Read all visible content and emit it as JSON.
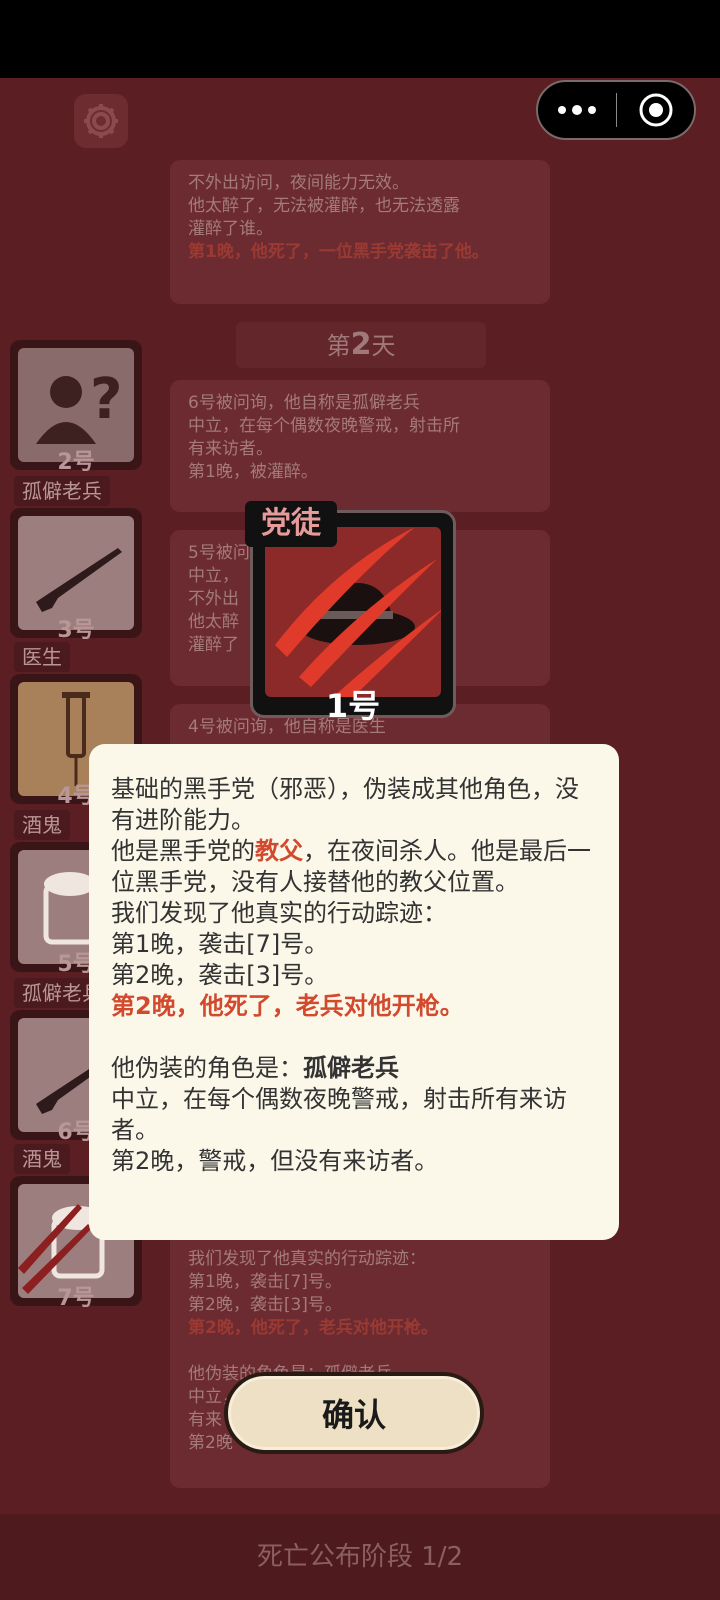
{
  "colors": {
    "background": "#5b1e22",
    "dialog_background": "#fbf8ea",
    "highlight_red": "#d2492e",
    "role_label": "#e79a9a"
  },
  "log": {
    "card1_lines": [
      "不外出访问，夜间能力无效。",
      "他太醉了，无法被灌醉，也无法透露",
      "灌醉了谁。"
    ],
    "card1_red": "第1晚，他死了，一位黑手党袭击了他。",
    "day_prefix": "第",
    "day_number": "2",
    "day_suffix": "天",
    "card2_lines": [
      "6号被问询，他自称是孤僻老兵",
      "中立，在每个偶数夜晚警戒，射击所",
      "有来访者。",
      "第1晚，被灌醉。"
    ],
    "card3_lines": [
      "5号被问询",
      "中立，",
      "不外出",
      "他太醉",
      "灌醉了"
    ],
    "card4_line": "4号被问询，他自称是医生",
    "card5_lines": [
      "我们发现了他真实的行动踪迹：",
      "第1晚，袭击[7]号。",
      "第2晚，袭击[3]号。"
    ],
    "card5_red": "第2晚，他死了，老兵对他开枪。",
    "card5_tail": [
      "他伪装的角色是：孤僻老兵",
      "中立，",
      "有来",
      "第2晚"
    ]
  },
  "players": [
    {
      "num": "2号",
      "tag": "",
      "icon": "unknown-user-icon"
    },
    {
      "num": "3号",
      "tag": "孤僻老兵",
      "icon": "rifle-icon"
    },
    {
      "num": "4号",
      "tag": "医生",
      "icon": "syringe-icon"
    },
    {
      "num": "5号",
      "tag": "酒鬼",
      "icon": "beer-mug-icon"
    },
    {
      "num": "6号",
      "tag": "孤僻老兵",
      "icon": "rifle-icon"
    },
    {
      "num": "7号",
      "tag": "酒鬼",
      "icon": "beer-mug-icon"
    }
  ],
  "reveal": {
    "role": "党徒",
    "num": "1号",
    "icon": "claw-mark-hat-icon"
  },
  "dialog": {
    "line1": "基础的黑手党（邪恶），伪装成其他角色，没有进阶能力。",
    "line2_pre": "他是黑手党的",
    "line2_hl": "教父",
    "line2_post": "，在夜间杀人。他是最后一位黑手党，没有人接替他的教父位置。",
    "line3": "我们发现了他真实的行动踪迹：",
    "line4": "第1晚，袭击[7]号。",
    "line5": "第2晚，袭击[3]号。",
    "line6": "第2晚，他死了，老兵对他开枪。",
    "line7_pre": "他伪装的角色是：",
    "line7_role": "孤僻老兵",
    "line8": "中立，在每个偶数夜晚警戒，射击所有来访者。",
    "line9": "第2晚，警戒，但没有来访者。"
  },
  "confirm_label": "确认",
  "phase": "死亡公布阶段 1/2"
}
